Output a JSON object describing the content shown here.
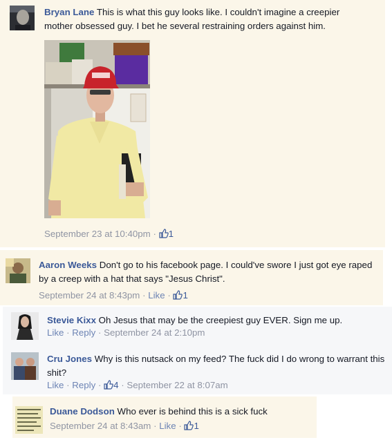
{
  "comments": [
    {
      "author": "Bryan Lane",
      "text": "This is what this guy looks like. I couldn't imagine a creepier mother obsessed guy. I bet he several restraining orders against him.",
      "timestamp": "September 23 at 10:40pm",
      "likes": "1",
      "photo_cap_text": "Jesus Christ"
    },
    {
      "author": "Aaron Weeks",
      "text": "Don't go to his facebook page. I could've swore I just got eye raped by a creep with a hat that says \"Jesus Christ\".",
      "timestamp": "September 24 at 8:43pm",
      "like_label": "Like",
      "likes": "1"
    },
    {
      "author": "Stevie Kixx",
      "text": "Oh Jesus that may be the creepiest guy EVER. Sign me up.",
      "like_label": "Like",
      "reply_label": "Reply",
      "timestamp": "September 24 at 2:10pm"
    },
    {
      "author": "Cru Jones",
      "text": "Why is this nutsack on my feed? The fuck did I do wrong to warrant this shit?",
      "like_label": "Like",
      "reply_label": "Reply",
      "likes": "4",
      "timestamp": "September 22 at 8:07am"
    },
    {
      "author": "Duane Dodson",
      "text": "Who ever is behind this is a sick fuck",
      "timestamp": "September 24 at 8:43am",
      "like_label": "Like",
      "likes": "1"
    }
  ],
  "separator": "·",
  "icons": {
    "like": "thumbs-up-icon"
  },
  "colors": {
    "name": "#3b5998",
    "meta": "#8f94a3",
    "highlight_bg": "#fbf6e9",
    "reply_bg": "#f6f7f9"
  }
}
